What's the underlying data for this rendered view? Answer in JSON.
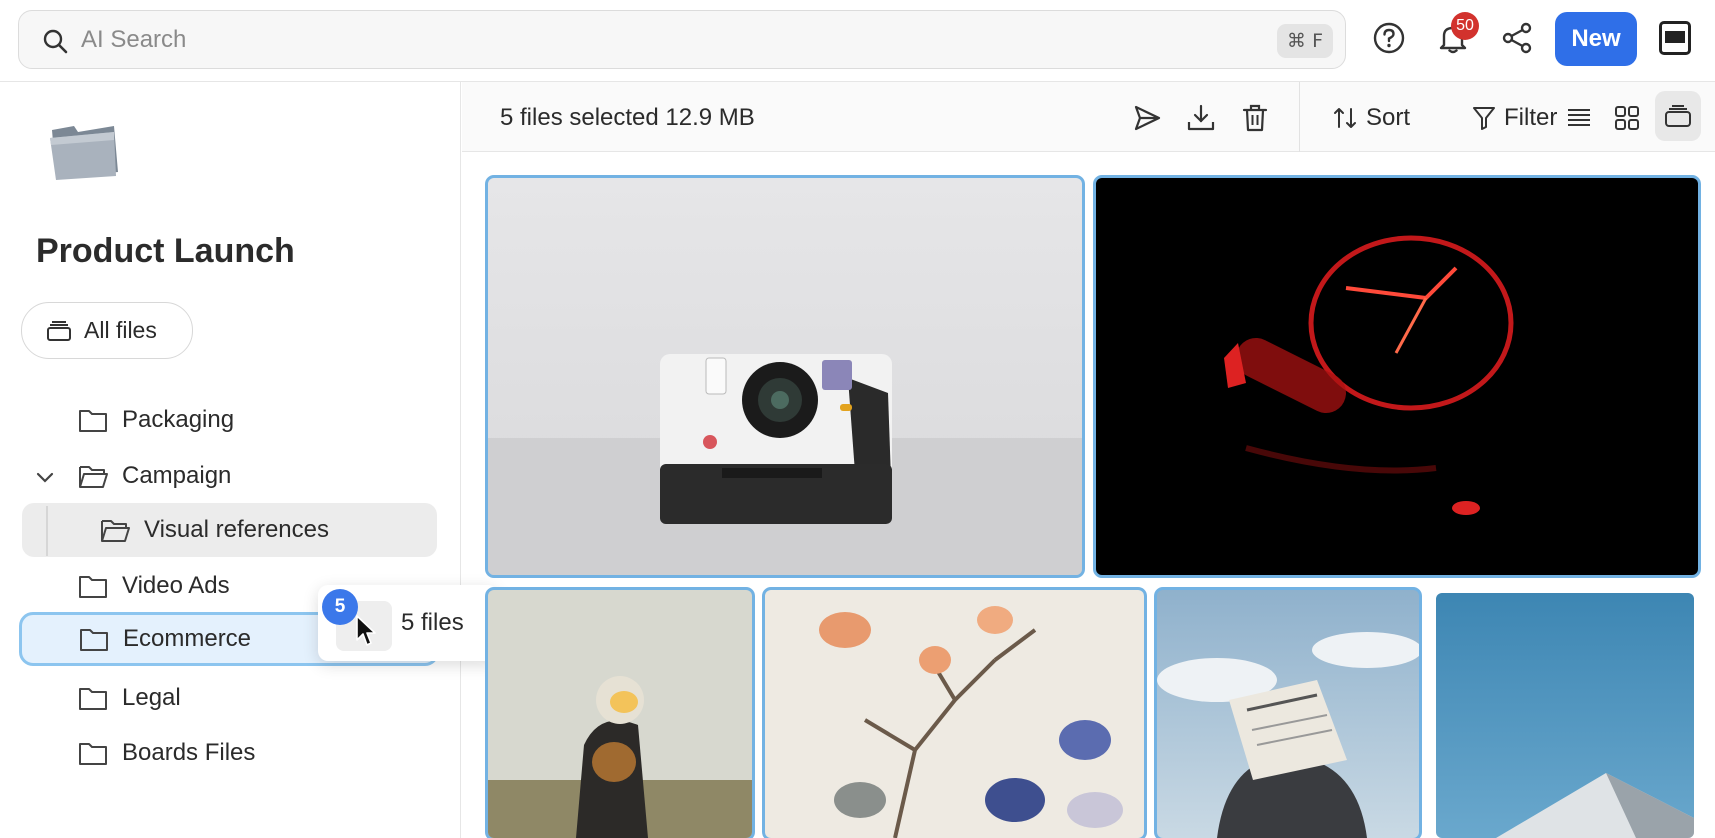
{
  "search": {
    "placeholder": "AI Search",
    "shortcut": "⌘ F"
  },
  "header": {
    "notification_count": "50",
    "new_label": "New"
  },
  "sidebar": {
    "project_title": "Product Launch",
    "all_files_label": "All files",
    "items": [
      {
        "label": "Packaging"
      },
      {
        "label": "Campaign"
      },
      {
        "label": "Visual references"
      },
      {
        "label": "Video Ads"
      },
      {
        "label": "Ecommerce"
      },
      {
        "label": "Legal"
      },
      {
        "label": "Boards Files"
      }
    ]
  },
  "drag": {
    "count": "5",
    "label": "5 files"
  },
  "toolbar": {
    "selection_text": "5 files selected 12.9 MB",
    "sort_label": "Sort",
    "filter_label": "Filter"
  },
  "icons": {
    "send": "send-icon",
    "download": "download-icon",
    "trash": "trash-icon",
    "help": "help-icon",
    "bell": "bell-icon",
    "share": "share-icon",
    "list_view": "list-view-icon",
    "grid_view": "grid-view-icon",
    "stack_view": "stack-view-icon"
  },
  "colors": {
    "accent": "#2f6fe8",
    "selection_outline": "#72b2e3",
    "badge": "#d2322d",
    "drop_target_bg": "#e4f1fd"
  }
}
